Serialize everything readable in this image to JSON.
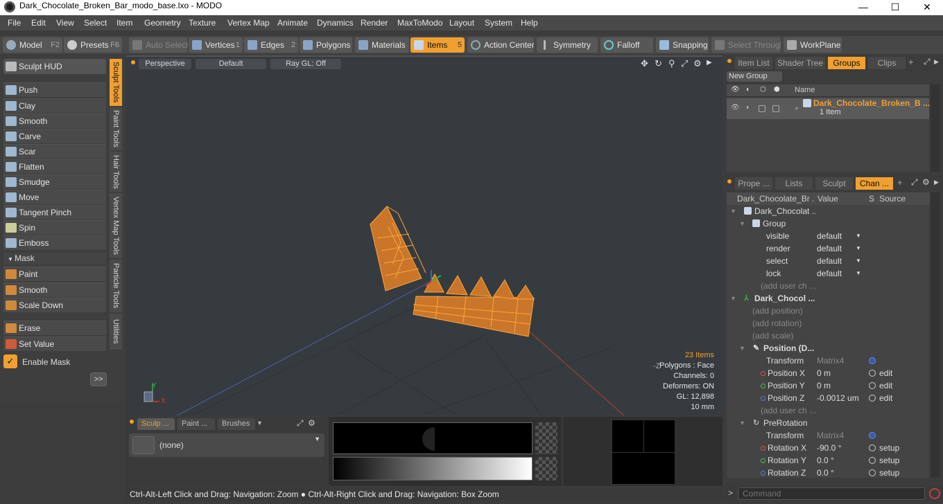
{
  "window": {
    "title": "Dark_Chocolate_Broken_Bar_modo_base.lxo - MODO",
    "minimize": "—",
    "maximize": "☐",
    "close": "✕"
  },
  "menu": [
    "File",
    "Edit",
    "View",
    "Select",
    "Item",
    "Geometry",
    "Texture",
    "Vertex Map",
    "Animate",
    "Dynamics",
    "Render",
    "MaxToModo",
    "Layout",
    "System",
    "Help"
  ],
  "toolbar": {
    "model": "Model",
    "model_key": "F2",
    "presets": "Presets",
    "presets_key": "F6",
    "auto_select": "Auto Select",
    "vertices": "Vertices",
    "vertices_key": "1",
    "edges": "Edges",
    "edges_key": "2",
    "polygons": "Polygons",
    "materials": "Materials",
    "items": "Items",
    "items_key": "5",
    "action_center": "Action Center",
    "symmetry": "Symmetry",
    "falloff": "Falloff",
    "snapping": "Snapping",
    "select_through": "Select Through",
    "workplane": "WorkPlane"
  },
  "sculpt": {
    "hud": "Sculpt HUD",
    "tools": [
      "Push",
      "Clay",
      "Smooth",
      "Carve",
      "Scar",
      "Flatten",
      "Smudge",
      "Move",
      "Tangent Pinch",
      "Spin",
      "Emboss"
    ],
    "mask_header": "Mask",
    "mask_tools": [
      "Paint",
      "Smooth",
      "Scale Down"
    ],
    "erase": "Erase",
    "set_value": "Set Value",
    "enable_mask": "Enable Mask",
    "more": ">>"
  },
  "vtabs": [
    "Sculpt Tools",
    "Paint Tools",
    "Hair Tools",
    "Vertex Map Tools",
    "Particle Tools",
    "Utilities"
  ],
  "viewport": {
    "view": "Perspective",
    "shading": "Default",
    "raygl": "Ray GL: Off",
    "info": {
      "items": "23 Items",
      "polygons": "Polygons : Face",
      "channels": "Channels: 0",
      "deformers": "Deformers: ON",
      "gl": "GL: 12,898",
      "scale": "10 mm"
    },
    "axis_y": "Y",
    "axis_x": "X",
    "axis_neg_z": "-Z"
  },
  "bottom": {
    "tabs": [
      "Sculp ...",
      "Paint ...",
      "Brushes"
    ],
    "brush": "(none)"
  },
  "status": "Ctrl-Alt-Left Click and Drag: Navigation: Zoom ● Ctrl-Alt-Right Click and Drag: Navigation: Box Zoom",
  "groups": {
    "tabs": [
      "Item List",
      "Shader Tree",
      "Groups",
      "Clips"
    ],
    "new_group": "New Group",
    "col_name": "Name",
    "item_name": "Dark_Chocolate_Broken_B ...",
    "item_count": "1 Item"
  },
  "channels": {
    "tabs": [
      "Prope ...",
      "Lists",
      "Sculpt",
      "Chan ..."
    ],
    "head": {
      "name": "Dark_Chocolate_Br ...",
      "value": "Value",
      "s": "S",
      "source": "Source"
    },
    "rows": [
      {
        "n": "Dark_Chocolat ...",
        "v": "",
        "src": ""
      },
      {
        "n": "Group",
        "v": "",
        "src": ""
      },
      {
        "n": "visible",
        "v": "default",
        "src": ""
      },
      {
        "n": "render",
        "v": "default",
        "src": ""
      },
      {
        "n": "select",
        "v": "default",
        "src": ""
      },
      {
        "n": "lock",
        "v": "default",
        "src": ""
      },
      {
        "n": "(add user ch ...",
        "v": "",
        "src": ""
      },
      {
        "n": "Dark_Chocol ...",
        "v": "",
        "src": ""
      },
      {
        "n": "(add position)",
        "v": "",
        "src": ""
      },
      {
        "n": "(add rotation)",
        "v": "",
        "src": ""
      },
      {
        "n": "(add scale)",
        "v": "",
        "src": ""
      },
      {
        "n": "Position (D...",
        "v": "",
        "src": ""
      },
      {
        "n": "Transform",
        "v": "Matrix4",
        "src": ""
      },
      {
        "n": "Position X",
        "v": "0 m",
        "src": "edit"
      },
      {
        "n": "Position Y",
        "v": "0 m",
        "src": "edit"
      },
      {
        "n": "Position Z",
        "v": "-0.0012 um",
        "src": "edit"
      },
      {
        "n": "(add user ch ...",
        "v": "",
        "src": ""
      },
      {
        "n": "PreRotation",
        "v": "",
        "src": ""
      },
      {
        "n": "Transform",
        "v": "Matrix4",
        "src": ""
      },
      {
        "n": "Rotation X",
        "v": "-90.0 °",
        "src": "setup"
      },
      {
        "n": "Rotation Y",
        "v": "0.0 °",
        "src": "setup"
      },
      {
        "n": "Rotation Z",
        "v": "0.0 °",
        "src": "setup"
      }
    ]
  },
  "command": {
    "placeholder": "Command",
    "prompt": ">"
  },
  "colors": {
    "accent": "#f0a030",
    "mesh": "#ffa53a",
    "bg": "#3c3c3c",
    "viewport": "#363b3f"
  }
}
